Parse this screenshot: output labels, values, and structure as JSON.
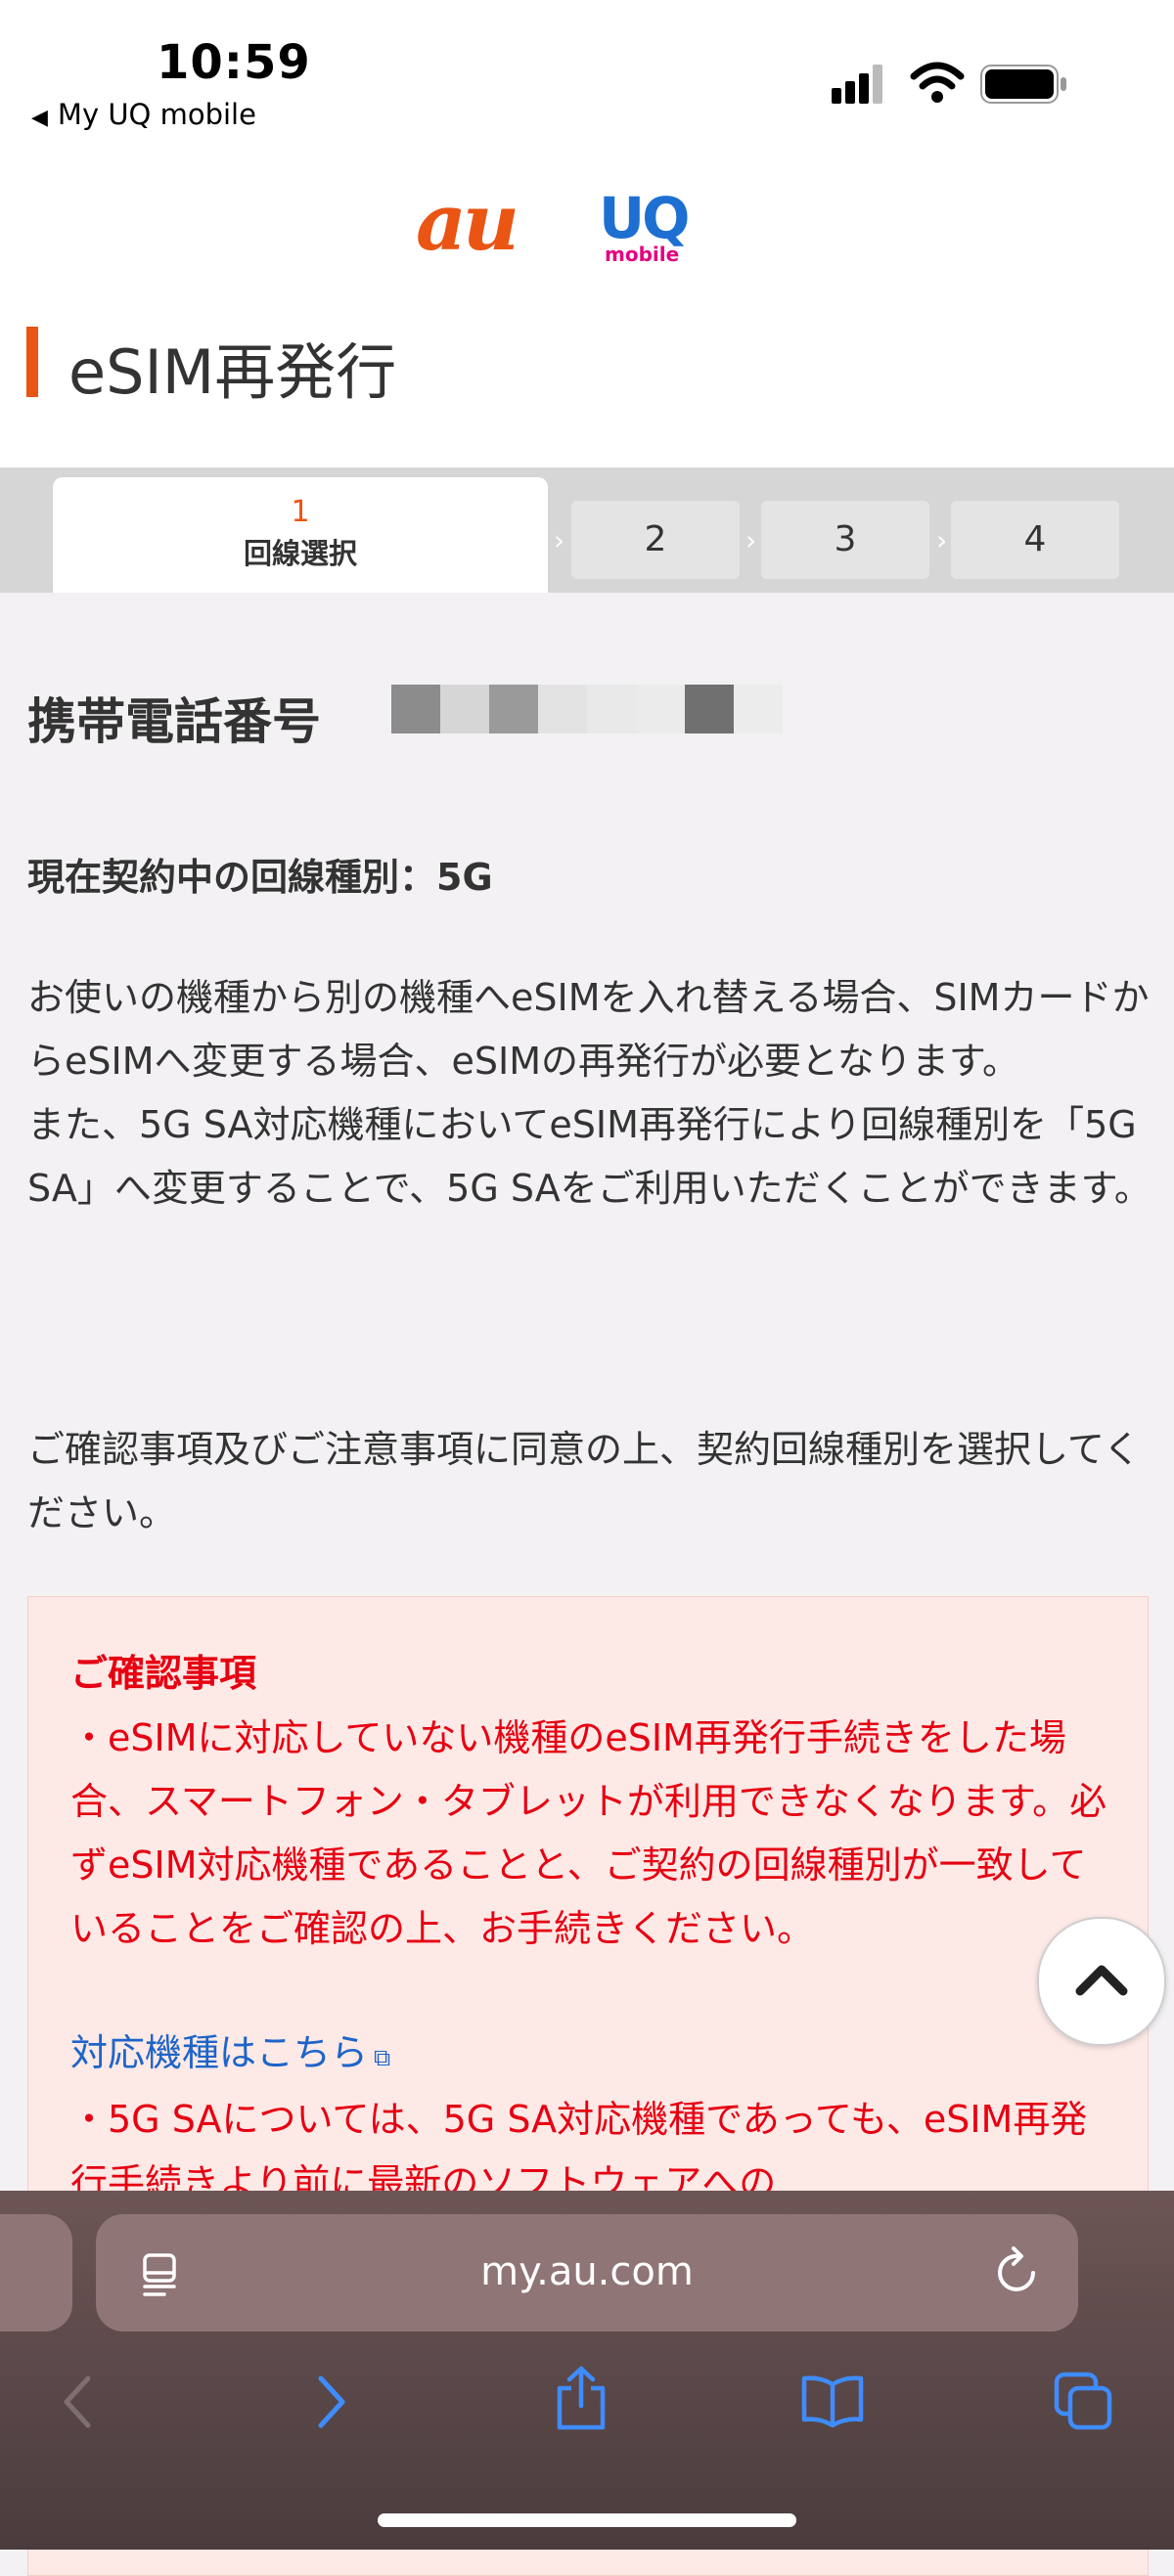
{
  "status": {
    "time": "10:59",
    "back_label": "My UQ mobile"
  },
  "brand": {
    "au": "au",
    "uq": "UQ",
    "uq_sub": "mobile"
  },
  "page_title": "eSIM再発行",
  "steps": [
    {
      "number": "1",
      "label": "回線選択"
    },
    {
      "number": "2"
    },
    {
      "number": "3"
    },
    {
      "number": "4"
    }
  ],
  "phone_label": "携帯電話番号",
  "line_type_text": "現在契約中の回線種別：5G",
  "intro_paragraphs": [
    "お使いの機種から別の機種へeSIMを入れ替える場合、SIMカードからeSIMへ変更する場合、eSIMの再発行が必要となります。",
    "また、5G SA対応機種においてeSIM再発行により回線種別を「5G SA」へ変更することで、5G SAをご利用いただくことができます。"
  ],
  "consent_text": "ご確認事項及びご注意事項に同意の上、契約回線種別を選択してください。",
  "confirm": {
    "heading": "ご確認事項",
    "item1": "・eSIMに対応していない機種のeSIM再発行手続きをした場合、スマートフォン・タブレットが利用できなくなります。必ずeSIM対応機種であることと、ご契約の回線種別が一致していることをご確認の上、お手続きください。",
    "link": "対応機種はこちら",
    "item2": "・5G SAについては、5G SA対応機種であっても、eSIM再発行手続きより前に最新のソフトウェアへの"
  },
  "browser": {
    "url": "my.au.com"
  },
  "colors": {
    "accent": "#ea5513",
    "warning": "#e60012",
    "link": "#1e64c8"
  }
}
